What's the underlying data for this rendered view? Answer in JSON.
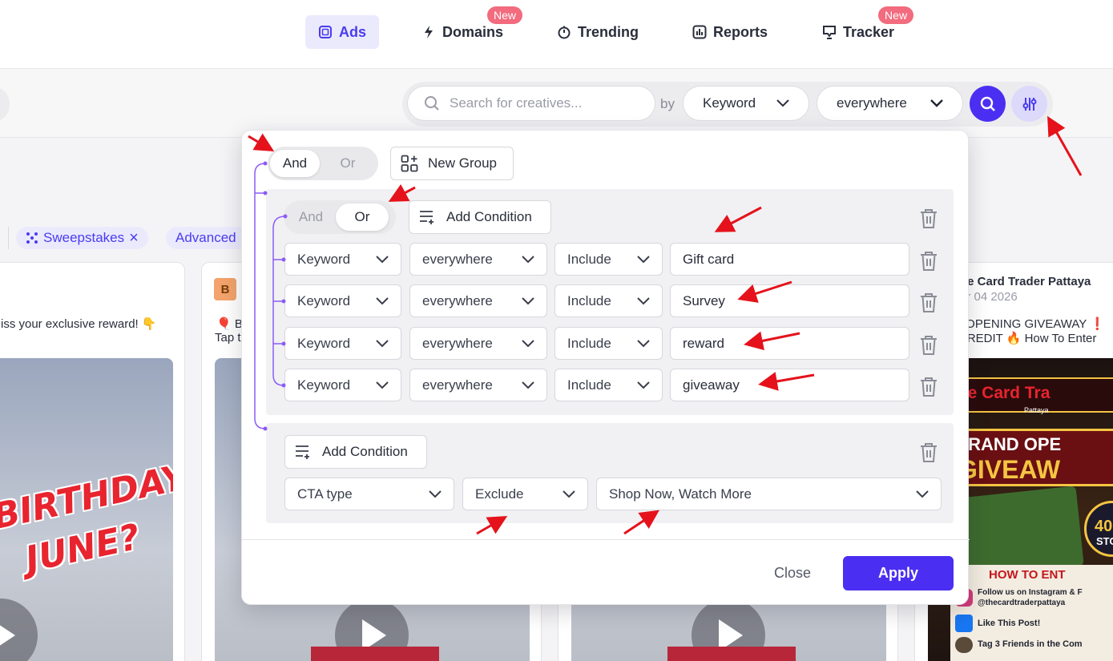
{
  "nav": {
    "items": [
      {
        "label": "Ads",
        "icon": "ads-icon",
        "active": true
      },
      {
        "label": "Domains",
        "icon": "bolt-icon",
        "badge": "New"
      },
      {
        "label": "Trending",
        "icon": "timer-icon"
      },
      {
        "label": "Reports",
        "icon": "chart-icon"
      },
      {
        "label": "Tracker",
        "icon": "tracker-icon",
        "badge": "New"
      }
    ]
  },
  "search": {
    "placeholder": "Search for creatives...",
    "by_label": "by",
    "field_select": "Keyword",
    "scope_select": "everywhere"
  },
  "chips": [
    {
      "label": "Sweepstakes",
      "close": "×"
    },
    {
      "label": "Advanced"
    }
  ],
  "cards": {
    "card1_text": "iss your exclusive reward! 👇",
    "card1_media_text_1": "BIRTHDAY",
    "card1_media_text_2": "JUNE?",
    "card2_avatar": "B",
    "card2_text_1": "🎈 Bo",
    "card2_text_2": "Tap t",
    "card4_title": "he Card Trader Pattaya",
    "card4_date": "ar 04 2026",
    "card4_text_1": ") OPENING GIVEAWAY ❗",
    "card4_text_2": "CREDIT 🔥 How To Enter",
    "card4_media": {
      "brand": "The Card Tra",
      "place": "Pattaya",
      "headline_1": "GRAND OPE",
      "headline_2": "GIVEAW",
      "badge": "400",
      "badge_sub": "STO",
      "how_to": "HOW TO ENT",
      "step1_a": "Follow us on Instagram & F",
      "step1_b": "@thecardtraderpattaya",
      "step2": "Like This Post!",
      "step3": "Tag 3 Friends in the Com"
    }
  },
  "filter": {
    "root_and": "And",
    "root_or": "Or",
    "root_selected": "And",
    "new_group": "New Group",
    "group1": {
      "and": "And",
      "or": "Or",
      "selected": "Or",
      "add_condition": "Add Condition",
      "rows": [
        {
          "field": "Keyword",
          "scope": "everywhere",
          "op": "Include",
          "value": "Gift card"
        },
        {
          "field": "Keyword",
          "scope": "everywhere",
          "op": "Include",
          "value": "Survey"
        },
        {
          "field": "Keyword",
          "scope": "everywhere",
          "op": "Include",
          "value": "reward"
        },
        {
          "field": "Keyword",
          "scope": "everywhere",
          "op": "Include",
          "value": "giveaway"
        }
      ]
    },
    "group2": {
      "add_condition": "Add Condition",
      "row": {
        "field": "CTA type",
        "op": "Exclude",
        "value": "Shop Now, Watch More"
      }
    },
    "close": "Close",
    "apply": "Apply"
  },
  "colors": {
    "accent": "#4a2ff2",
    "accent_light": "#ebeafd",
    "badge": "#f26b7e",
    "annotation_arrow": "#e5121b",
    "connector": "#8b5cf6"
  }
}
